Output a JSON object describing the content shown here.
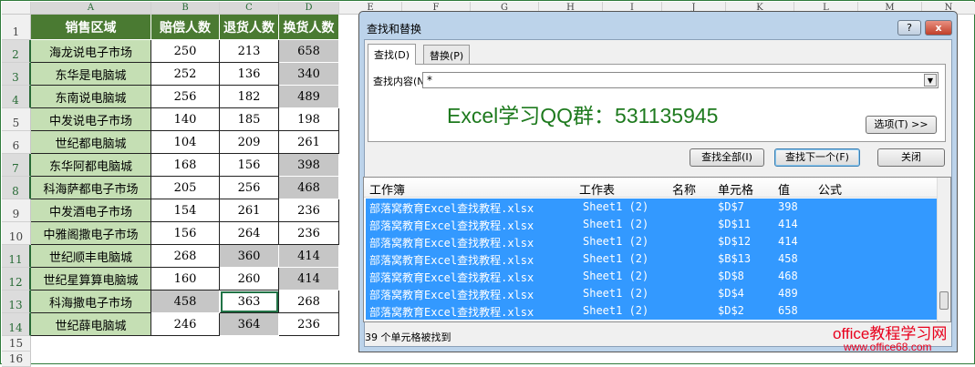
{
  "columns": [
    "A",
    "B",
    "C",
    "D",
    "E",
    "F",
    "G",
    "H",
    "I",
    "J",
    "K",
    "L",
    "M",
    "N"
  ],
  "headers": [
    "销售区域",
    "赔偿人数",
    "退货人数",
    "换货人数"
  ],
  "rows": [
    {
      "n": "2",
      "area": "海龙说电子市场",
      "b": "250",
      "c": "213",
      "d": "658"
    },
    {
      "n": "3",
      "area": "东华是电脑城",
      "b": "252",
      "c": "136",
      "d": "340"
    },
    {
      "n": "4",
      "area": "东南说电脑城",
      "b": "256",
      "c": "182",
      "d": "489"
    },
    {
      "n": "5",
      "area": "中发说电子市场",
      "b": "140",
      "c": "185",
      "d": "198"
    },
    {
      "n": "6",
      "area": "世纪都电脑城",
      "b": "104",
      "c": "209",
      "d": "261"
    },
    {
      "n": "7",
      "area": "东华阿都电脑城",
      "b": "168",
      "c": "156",
      "d": "398"
    },
    {
      "n": "8",
      "area": "科海萨都电子市场",
      "b": "205",
      "c": "256",
      "d": "468"
    },
    {
      "n": "9",
      "area": "中发酒电子市场",
      "b": "154",
      "c": "261",
      "d": "236"
    },
    {
      "n": "10",
      "area": "中雅阁撒电子市场",
      "b": "156",
      "c": "264",
      "d": "236"
    },
    {
      "n": "11",
      "area": "世纪顺丰电脑城",
      "b": "268",
      "c": "360",
      "d": "414"
    },
    {
      "n": "12",
      "area": "世纪星算算电脑城",
      "b": "160",
      "c": "260",
      "d": "414"
    },
    {
      "n": "13",
      "area": "科海撒电子市场",
      "b": "458",
      "c": "363",
      "d": "268"
    },
    {
      "n": "14",
      "area": "世纪薛电脑城",
      "b": "246",
      "c": "364",
      "d": "236"
    }
  ],
  "extra_rows": [
    "1",
    "15",
    "16"
  ],
  "highlighted_cells": [
    "D2",
    "D3",
    "D4",
    "D7",
    "D8",
    "C11",
    "D11",
    "D12",
    "B13",
    "C14"
  ],
  "active_cell": "C13",
  "dialog": {
    "title": "查找和替换",
    "help": "?",
    "close": "x",
    "tabs": [
      "查找(D)",
      "替换(P)"
    ],
    "find_label": "查找内容(N):",
    "find_value": "*",
    "watermark": "Excel学习QQ群：531135945",
    "options_button": "选项(T) >>",
    "find_all": "查找全部(I)",
    "find_next": "查找下一个(F)",
    "close_button": "关闭",
    "list_headers": [
      "工作簿",
      "工作表",
      "名称",
      "单元格",
      "值",
      "公式"
    ],
    "results": [
      {
        "book": "部落窝教育Excel查找教程.xlsx",
        "sheet": "Sheet1 (2)",
        "cell": "$D$7",
        "value": "398"
      },
      {
        "book": "部落窝教育Excel查找教程.xlsx",
        "sheet": "Sheet1 (2)",
        "cell": "$D$11",
        "value": "414"
      },
      {
        "book": "部落窝教育Excel查找教程.xlsx",
        "sheet": "Sheet1 (2)",
        "cell": "$D$12",
        "value": "414"
      },
      {
        "book": "部落窝教育Excel查找教程.xlsx",
        "sheet": "Sheet1 (2)",
        "cell": "$B$13",
        "value": "458"
      },
      {
        "book": "部落窝教育Excel查找教程.xlsx",
        "sheet": "Sheet1 (2)",
        "cell": "$D$8",
        "value": "468"
      },
      {
        "book": "部落窝教育Excel查找教程.xlsx",
        "sheet": "Sheet1 (2)",
        "cell": "$D$4",
        "value": "489"
      },
      {
        "book": "部落窝教育Excel查找教程.xlsx",
        "sheet": "Sheet1 (2)",
        "cell": "$D$2",
        "value": "658"
      }
    ],
    "status": "39 个单元格被找到"
  },
  "site_watermark": {
    "name": "office教程学习网",
    "url": "www.office68.com"
  },
  "colors": {
    "header_green": "#4a7a32",
    "area_green": "#c5dfb4",
    "highlight_grey": "#c6c6c6",
    "selection_blue": "#3399ff",
    "watermark_green": "#1e7a1e",
    "watermark_red": "#e8001c"
  }
}
